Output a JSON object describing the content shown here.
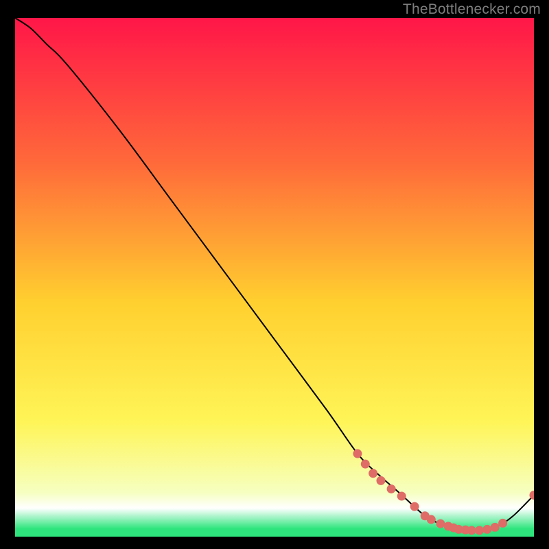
{
  "attribution": "TheBottlenecker.com",
  "colors": {
    "bg": "#000000",
    "grad_top": "#ff1648",
    "grad_upper": "#ff6a3a",
    "grad_mid": "#ffd02f",
    "grad_lower": "#fff558",
    "grad_pale": "#f6ffc0",
    "grad_white": "#ffffff",
    "grad_green": "#2de57c",
    "curve": "#000000",
    "marker": "#df6c66",
    "text": "#7d7d7d"
  },
  "chart_data": {
    "type": "line",
    "title": "",
    "xlabel": "",
    "ylabel": "",
    "xlim": [
      0,
      100
    ],
    "ylim": [
      0,
      100
    ],
    "series": [
      {
        "name": "bottleneck-curve",
        "x": [
          0,
          3,
          6,
          10,
          20,
          30,
          40,
          50,
          60,
          66,
          70,
          74,
          79,
          82,
          86,
          90,
          93,
          96,
          100
        ],
        "y": [
          100,
          98,
          95,
          91,
          78.5,
          65,
          51.5,
          38,
          24.5,
          16,
          12,
          8.5,
          4,
          2.5,
          1.3,
          1.2,
          2,
          4,
          8
        ]
      }
    ],
    "markers": {
      "name": "data-points",
      "x": [
        66,
        67.5,
        69,
        70.5,
        72.5,
        74.5,
        77,
        79,
        80.2,
        82,
        83.5,
        84.5,
        85.5,
        86.8,
        88,
        89.5,
        91,
        92.5,
        94,
        100
      ],
      "y": [
        16,
        14,
        12.2,
        10.8,
        9.2,
        7.8,
        5.8,
        4,
        3.3,
        2.5,
        2,
        1.7,
        1.4,
        1.3,
        1.2,
        1.2,
        1.4,
        1.8,
        2.6,
        8
      ]
    },
    "gradient_stops": [
      {
        "offset": 0.0,
        "key": "grad_top"
      },
      {
        "offset": 0.28,
        "key": "grad_upper"
      },
      {
        "offset": 0.55,
        "key": "grad_mid"
      },
      {
        "offset": 0.78,
        "key": "grad_lower"
      },
      {
        "offset": 0.915,
        "key": "grad_pale"
      },
      {
        "offset": 0.945,
        "key": "grad_white"
      },
      {
        "offset": 0.985,
        "key": "grad_green"
      },
      {
        "offset": 1.0,
        "key": "grad_green"
      }
    ]
  }
}
